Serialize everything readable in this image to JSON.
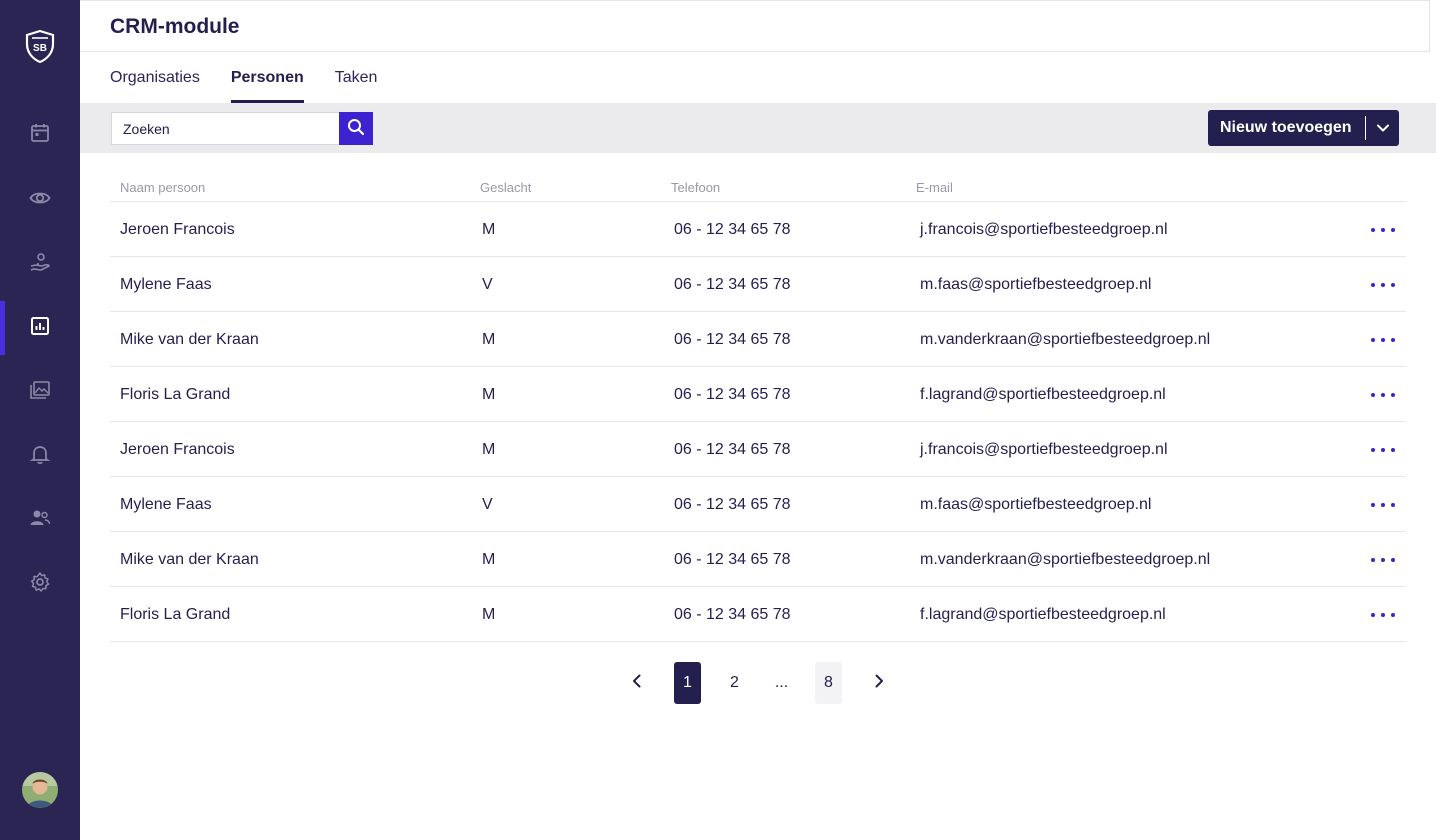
{
  "app": {
    "title": "CRM-module",
    "brand_color": "#2a2552",
    "accent_color": "#3d22cf"
  },
  "sidebar": {
    "logo": "sb-shield-logo",
    "items": [
      {
        "icon": "calendar-icon",
        "active": false
      },
      {
        "icon": "eye-icon",
        "active": false
      },
      {
        "icon": "hand-coin-icon",
        "active": false
      },
      {
        "icon": "report-chart-icon",
        "active": true
      },
      {
        "icon": "gallery-icon",
        "active": false
      },
      {
        "icon": "bell-icon",
        "active": false
      },
      {
        "icon": "users-icon",
        "active": false
      },
      {
        "icon": "gear-icon",
        "active": false
      }
    ],
    "avatar": "user-avatar"
  },
  "tabs": [
    {
      "label": "Organisaties",
      "active": false
    },
    {
      "label": "Personen",
      "active": true
    },
    {
      "label": "Taken",
      "active": false
    }
  ],
  "toolbar": {
    "search_placeholder": "Zoeken",
    "search_value": "",
    "add_label": "Nieuw toevoegen"
  },
  "table": {
    "columns": [
      "Naam persoon",
      "Geslacht",
      "Telefoon",
      "E-mail"
    ],
    "rows": [
      {
        "name": "Jeroen Francois",
        "gender": "M",
        "phone": "06 - 12 34 65 78",
        "email": "j.francois@sportiefbesteedgroep.nl"
      },
      {
        "name": "Mylene Faas",
        "gender": "V",
        "phone": "06 - 12 34 65 78",
        "email": "m.faas@sportiefbesteedgroep.nl"
      },
      {
        "name": "Mike van der Kraan",
        "gender": "M",
        "phone": "06 - 12 34 65 78",
        "email": "m.vanderkraan@sportiefbesteedgroep.nl"
      },
      {
        "name": "Floris La Grand",
        "gender": "M",
        "phone": "06 - 12 34 65 78",
        "email": "f.lagrand@sportiefbesteedgroep.nl"
      },
      {
        "name": "Jeroen Francois",
        "gender": "M",
        "phone": "06 - 12 34 65 78",
        "email": "j.francois@sportiefbesteedgroep.nl"
      },
      {
        "name": "Mylene Faas",
        "gender": "V",
        "phone": "06 - 12 34 65 78",
        "email": "m.faas@sportiefbesteedgroep.nl"
      },
      {
        "name": "Mike van der Kraan",
        "gender": "M",
        "phone": "06 - 12 34 65 78",
        "email": "m.vanderkraan@sportiefbesteedgroep.nl"
      },
      {
        "name": "Floris La Grand",
        "gender": "M",
        "phone": "06 - 12 34 65 78",
        "email": "f.lagrand@sportiefbesteedgroep.nl"
      }
    ]
  },
  "pagination": {
    "pages": [
      "1",
      "2",
      "...",
      "8"
    ],
    "current": "1"
  }
}
